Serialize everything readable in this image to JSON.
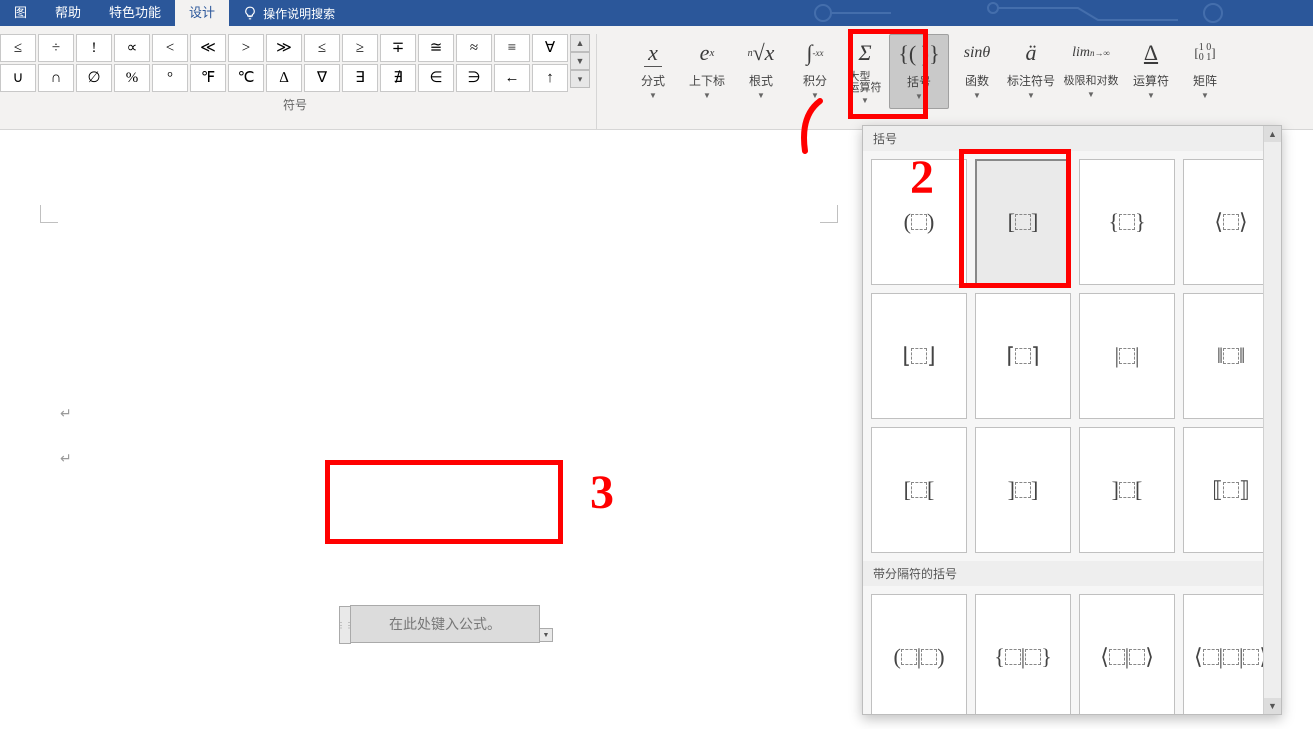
{
  "tabs": {
    "t0": "图",
    "t1": "帮助",
    "t2": "特色功能",
    "t3": "设计",
    "search": "操作说明搜索"
  },
  "symbols": {
    "row1": [
      "≤",
      "÷",
      "!",
      "∝",
      "<",
      "≪",
      ">",
      "≫",
      "≤",
      "≥",
      "∓",
      "≅",
      "≈",
      "≡",
      "∀"
    ],
    "row2": [
      "∪",
      "∩",
      "∅",
      "%",
      "°",
      "℉",
      "℃",
      "∆",
      "∇",
      "∃",
      "∄",
      "∈",
      "∋",
      "←",
      "↑"
    ],
    "group_label": "符号"
  },
  "struct": {
    "frac": "分式",
    "script": "上下标",
    "radical": "根式",
    "integral": "积分",
    "largeop": "大型\n运算符",
    "bracket": "括号",
    "func": "函数",
    "accent": "标注符号",
    "limit": "极限和对数",
    "operator": "运算符",
    "matrix": "矩阵"
  },
  "eq_placeholder": "在此处键入公式。",
  "gallery": {
    "section1": "括号",
    "section2": "带分隔符的括号",
    "row1": [
      "( )",
      "[ ]",
      "{ }",
      "⟨ ⟩"
    ],
    "row2": [
      "⌊ ⌋",
      "⌈ ⌉",
      "| |",
      "‖ ‖"
    ],
    "row3": [
      "[ [",
      "] ]",
      "] [",
      "⟦ ⟧"
    ],
    "row4": [
      "( | )",
      "{ | }",
      "⟨ | ⟩",
      "⟨ | | ⟩"
    ]
  },
  "annotations": {
    "a1": "1",
    "a2": "2",
    "a3": "3"
  }
}
